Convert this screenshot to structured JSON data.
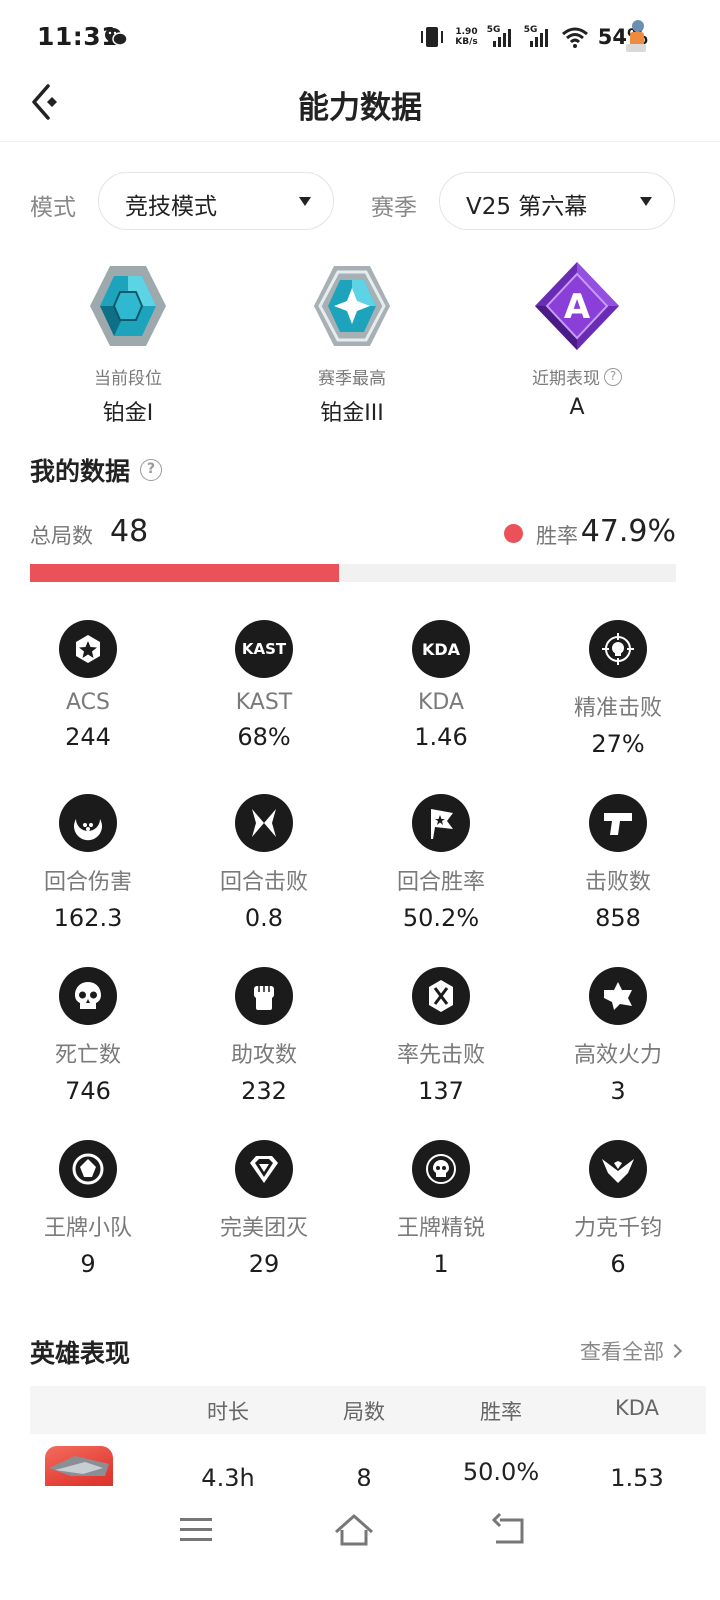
{
  "status_bar": {
    "time": "11:31",
    "net_speed_value": "1.90",
    "net_speed_unit": "KB/s",
    "sim1": "5G",
    "sim2": "5G",
    "battery": "54%"
  },
  "header": {
    "title": "能力数据"
  },
  "filters": {
    "mode_label": "模式",
    "mode_value": "竞技模式",
    "season_label": "赛季",
    "season_value": "V25 第六幕"
  },
  "ranks": [
    {
      "label": "当前段位",
      "value": "铂金I"
    },
    {
      "label": "赛季最高",
      "value": "铂金III"
    },
    {
      "label": "近期表现",
      "value": "A",
      "emblem_letter": "A"
    }
  ],
  "my_data": {
    "title": "我的数据",
    "total_label": "总局数",
    "total_value": "48",
    "win_label": "胜率",
    "win_value": "47.9%",
    "win_fraction": 0.479
  },
  "stats": [
    {
      "icon": "star-hexagon-icon",
      "icon_text": "",
      "name": "ACS",
      "value": "244"
    },
    {
      "icon": "kast-icon",
      "icon_text": "KAST",
      "name": "KAST",
      "value": "68%"
    },
    {
      "icon": "kda-icon",
      "icon_text": "KDA",
      "name": "KDA",
      "value": "1.46"
    },
    {
      "icon": "crosshair-skull-icon",
      "icon_text": "",
      "name": "精准击败",
      "value": "27%"
    },
    {
      "icon": "crescent-icon",
      "icon_text": "",
      "name": "回合伤害",
      "value": "162.3"
    },
    {
      "icon": "crossed-blades-icon",
      "icon_text": "",
      "name": "回合击败",
      "value": "0.8"
    },
    {
      "icon": "flag-icon",
      "icon_text": "",
      "name": "回合胜率",
      "value": "50.2%"
    },
    {
      "icon": "pistol-icon",
      "icon_text": "",
      "name": "击败数",
      "value": "858"
    },
    {
      "icon": "skull-icon",
      "icon_text": "",
      "name": "死亡数",
      "value": "746"
    },
    {
      "icon": "fist-icon",
      "icon_text": "",
      "name": "助攻数",
      "value": "232"
    },
    {
      "icon": "first-blood-icon",
      "icon_text": "",
      "name": "率先击败",
      "value": "137"
    },
    {
      "icon": "fire-icon",
      "icon_text": "",
      "name": "高效火力",
      "value": "3"
    },
    {
      "icon": "ace-squad-icon",
      "icon_text": "",
      "name": "王牌小队",
      "value": "9"
    },
    {
      "icon": "diamond-icon",
      "icon_text": "",
      "name": "完美团灭",
      "value": "29"
    },
    {
      "icon": "elite-skull-icon",
      "icon_text": "",
      "name": "王牌精锐",
      "value": "1"
    },
    {
      "icon": "wings-icon",
      "icon_text": "",
      "name": "力克千钧",
      "value": "6"
    }
  ],
  "heroes": {
    "title": "英雄表现",
    "see_all": "查看全部",
    "columns": [
      "时长",
      "局数",
      "胜率",
      "KDA"
    ],
    "rows": [
      {
        "duration": "4.3h",
        "games": "8",
        "win_rate": "50.0%",
        "kda": "1.53"
      }
    ]
  },
  "colors": {
    "accent": "#ea5158",
    "icon_bg": "#1b1b1b"
  }
}
